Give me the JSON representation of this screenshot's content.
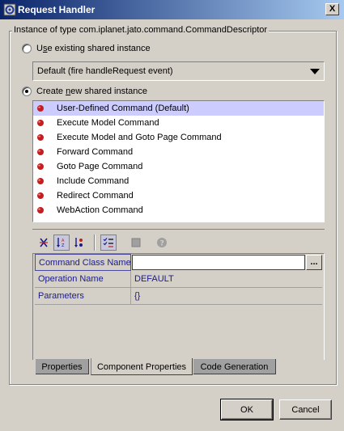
{
  "window": {
    "title": "Request Handler",
    "close_glyph": "X"
  },
  "group": {
    "legend": "Instance of type com.iplanet.jato.command.CommandDescriptor"
  },
  "radio_existing": {
    "pre": "U",
    "mnemonic": "s",
    "post": "e existing shared instance",
    "checked": false
  },
  "shared_combo": {
    "selected": "Default (fire handleRequest event)"
  },
  "radio_new": {
    "pre": "Create ",
    "mnemonic": "n",
    "post": "ew shared instance",
    "checked": true
  },
  "commands": [
    {
      "label": "User-Defined Command (Default)",
      "selected": true,
      "icon": "bean-icon"
    },
    {
      "label": "Execute Model Command",
      "selected": false,
      "icon": "bean-icon"
    },
    {
      "label": "Execute Model and Goto Page Command",
      "selected": false,
      "icon": "bean-icon"
    },
    {
      "label": "Forward Command",
      "selected": false,
      "icon": "bean-icon"
    },
    {
      "label": "Goto Page Command",
      "selected": false,
      "icon": "bean-icon"
    },
    {
      "label": "Include Command",
      "selected": false,
      "icon": "bean-icon"
    },
    {
      "label": "Redirect Command",
      "selected": false,
      "icon": "bean-icon"
    },
    {
      "label": "WebAction Command",
      "selected": false,
      "icon": "bean-icon"
    }
  ],
  "toolbar": {
    "icons": [
      "unsorted-icon",
      "sort-by-name-icon",
      "sort-by-type-icon",
      "property-list-icon",
      "customizer-icon",
      "help-icon"
    ]
  },
  "properties": [
    {
      "name": "Command Class Name",
      "value": "",
      "editor": "ellipsis-button",
      "ellipsis": "..."
    },
    {
      "name": "Operation Name",
      "value": "DEFAULT"
    },
    {
      "name": "Parameters",
      "value": "{}"
    }
  ],
  "tabs": [
    {
      "label": "Properties",
      "active": false
    },
    {
      "label": "Component Properties",
      "active": true
    },
    {
      "label": "Code Generation",
      "active": false
    }
  ],
  "buttons": {
    "ok": "OK",
    "cancel": "Cancel"
  },
  "colors": {
    "title_start": "#0a246a",
    "title_end": "#a6caf0",
    "selection": "#ccccff",
    "property_text": "#1a1a8c",
    "bean_icon": "#c41e1e"
  }
}
